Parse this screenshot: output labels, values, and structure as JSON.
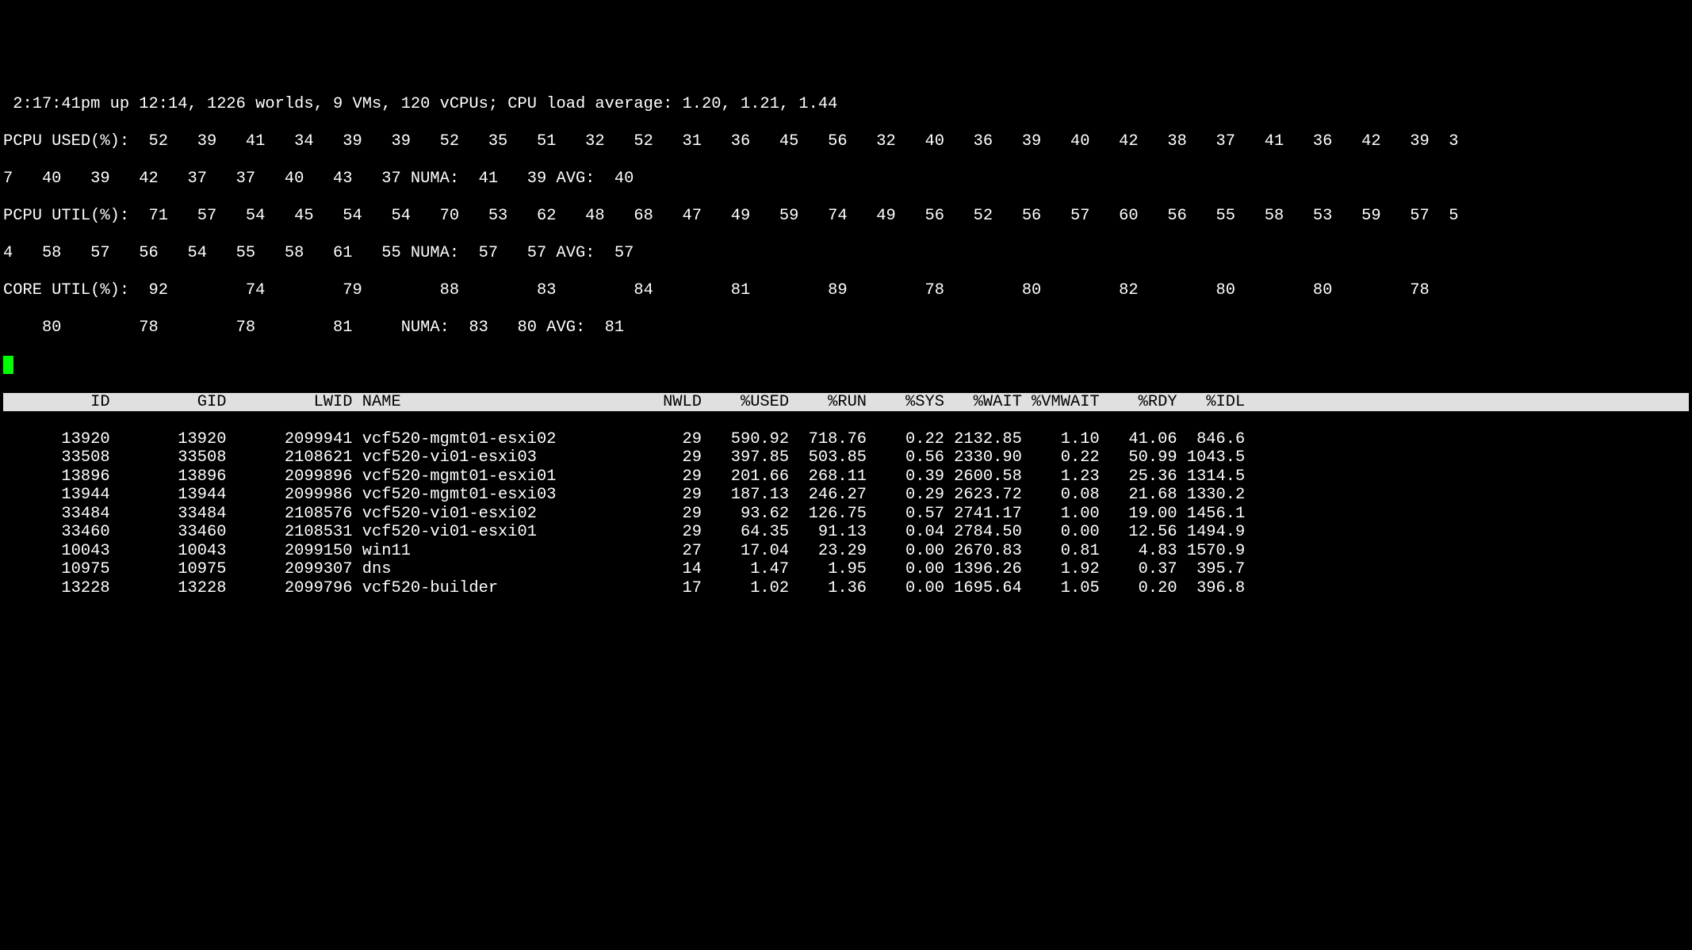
{
  "header": {
    "line1": " 2:17:41pm up 12:14, 1226 worlds, 9 VMs, 120 vCPUs; CPU load average: 1.20, 1.21, 1.44",
    "pcpu_used_line1": "PCPU USED(%):  52   39   41   34   39   39   52   35   51   32   52   31   36   45   56   32   40   36   39   40   42   38   37   41   36   42   39  3",
    "pcpu_used_line2": "7   40   39   42   37   37   40   43   37 NUMA:  41   39 AVG:  40",
    "pcpu_util_line1": "PCPU UTIL(%):  71   57   54   45   54   54   70   53   62   48   68   47   49   59   74   49   56   52   56   57   60   56   55   58   53   59   57  5",
    "pcpu_util_line2": "4   58   57   56   54   55   58   61   55 NUMA:  57   57 AVG:  57",
    "core_util_line1": "CORE UTIL(%):  92        74        79        88        83        84        81        89        78        80        82        80        80        78  ",
    "core_util_line2": "    80        78        78        81     NUMA:  83   80 AVG:  81"
  },
  "columns": {
    "header_text": "         ID         GID         LWID NAME                           NWLD    %USED    %RUN    %SYS   %WAIT %VMWAIT    %RDY   %IDL"
  },
  "rows": [
    {
      "id": "13920",
      "gid": "13920",
      "lwid": "2099941",
      "name": "vcf520-mgmt01-esxi02",
      "nwld": "29",
      "used": "590.92",
      "run": "718.76",
      "sys": "0.22",
      "wait": "2132.85",
      "vmwait": "1.10",
      "rdy": "41.06",
      "idl": "846.6"
    },
    {
      "id": "33508",
      "gid": "33508",
      "lwid": "2108621",
      "name": "vcf520-vi01-esxi03",
      "nwld": "29",
      "used": "397.85",
      "run": "503.85",
      "sys": "0.56",
      "wait": "2330.90",
      "vmwait": "0.22",
      "rdy": "50.99",
      "idl": "1043.5"
    },
    {
      "id": "13896",
      "gid": "13896",
      "lwid": "2099896",
      "name": "vcf520-mgmt01-esxi01",
      "nwld": "29",
      "used": "201.66",
      "run": "268.11",
      "sys": "0.39",
      "wait": "2600.58",
      "vmwait": "1.23",
      "rdy": "25.36",
      "idl": "1314.5"
    },
    {
      "id": "13944",
      "gid": "13944",
      "lwid": "2099986",
      "name": "vcf520-mgmt01-esxi03",
      "nwld": "29",
      "used": "187.13",
      "run": "246.27",
      "sys": "0.29",
      "wait": "2623.72",
      "vmwait": "0.08",
      "rdy": "21.68",
      "idl": "1330.2"
    },
    {
      "id": "33484",
      "gid": "33484",
      "lwid": "2108576",
      "name": "vcf520-vi01-esxi02",
      "nwld": "29",
      "used": "93.62",
      "run": "126.75",
      "sys": "0.57",
      "wait": "2741.17",
      "vmwait": "1.00",
      "rdy": "19.00",
      "idl": "1456.1"
    },
    {
      "id": "33460",
      "gid": "33460",
      "lwid": "2108531",
      "name": "vcf520-vi01-esxi01",
      "nwld": "29",
      "used": "64.35",
      "run": "91.13",
      "sys": "0.04",
      "wait": "2784.50",
      "vmwait": "0.00",
      "rdy": "12.56",
      "idl": "1494.9"
    },
    {
      "id": "10043",
      "gid": "10043",
      "lwid": "2099150",
      "name": "win11",
      "nwld": "27",
      "used": "17.04",
      "run": "23.29",
      "sys": "0.00",
      "wait": "2670.83",
      "vmwait": "0.81",
      "rdy": "4.83",
      "idl": "1570.9"
    },
    {
      "id": "10975",
      "gid": "10975",
      "lwid": "2099307",
      "name": "dns",
      "nwld": "14",
      "used": "1.47",
      "run": "1.95",
      "sys": "0.00",
      "wait": "1396.26",
      "vmwait": "1.92",
      "rdy": "0.37",
      "idl": "395.7"
    },
    {
      "id": "13228",
      "gid": "13228",
      "lwid": "2099796",
      "name": "vcf520-builder",
      "nwld": "17",
      "used": "1.02",
      "run": "1.36",
      "sys": "0.00",
      "wait": "1695.64",
      "vmwait": "1.05",
      "rdy": "0.20",
      "idl": "396.8"
    }
  ]
}
